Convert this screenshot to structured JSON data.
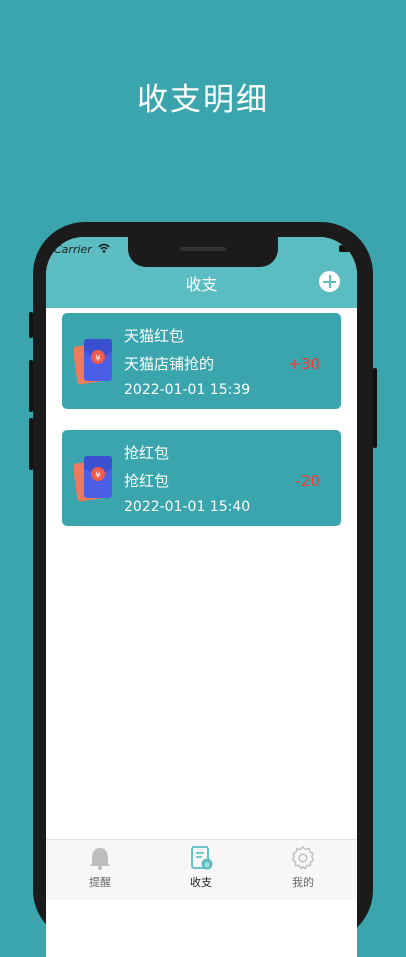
{
  "promo": {
    "title": "收支明细"
  },
  "status_bar": {
    "carrier": "Carrier"
  },
  "header": {
    "title": "收支",
    "add_icon": "plus-circle-icon"
  },
  "records": [
    {
      "title": "天猫红包",
      "subtitle": "天猫店铺抢的",
      "datetime": "2022-01-01 15:39",
      "amount": "+30",
      "icon": "red-packet-icon"
    },
    {
      "title": "抢红包",
      "subtitle": "抢红包",
      "datetime": "2022-01-01 15:40",
      "amount": "-20",
      "icon": "red-packet-icon"
    }
  ],
  "tabs": [
    {
      "label": "提醒",
      "icon": "bell-icon"
    },
    {
      "label": "收支",
      "icon": "ledger-icon",
      "active": true
    },
    {
      "label": "我的",
      "icon": "gear-icon"
    }
  ],
  "colors": {
    "background": "#3aa5ac",
    "header": "#5bbcc2",
    "card": "#3aa5ac",
    "amount": "#ef3b3b",
    "active_tab": "#5bbcc2"
  }
}
